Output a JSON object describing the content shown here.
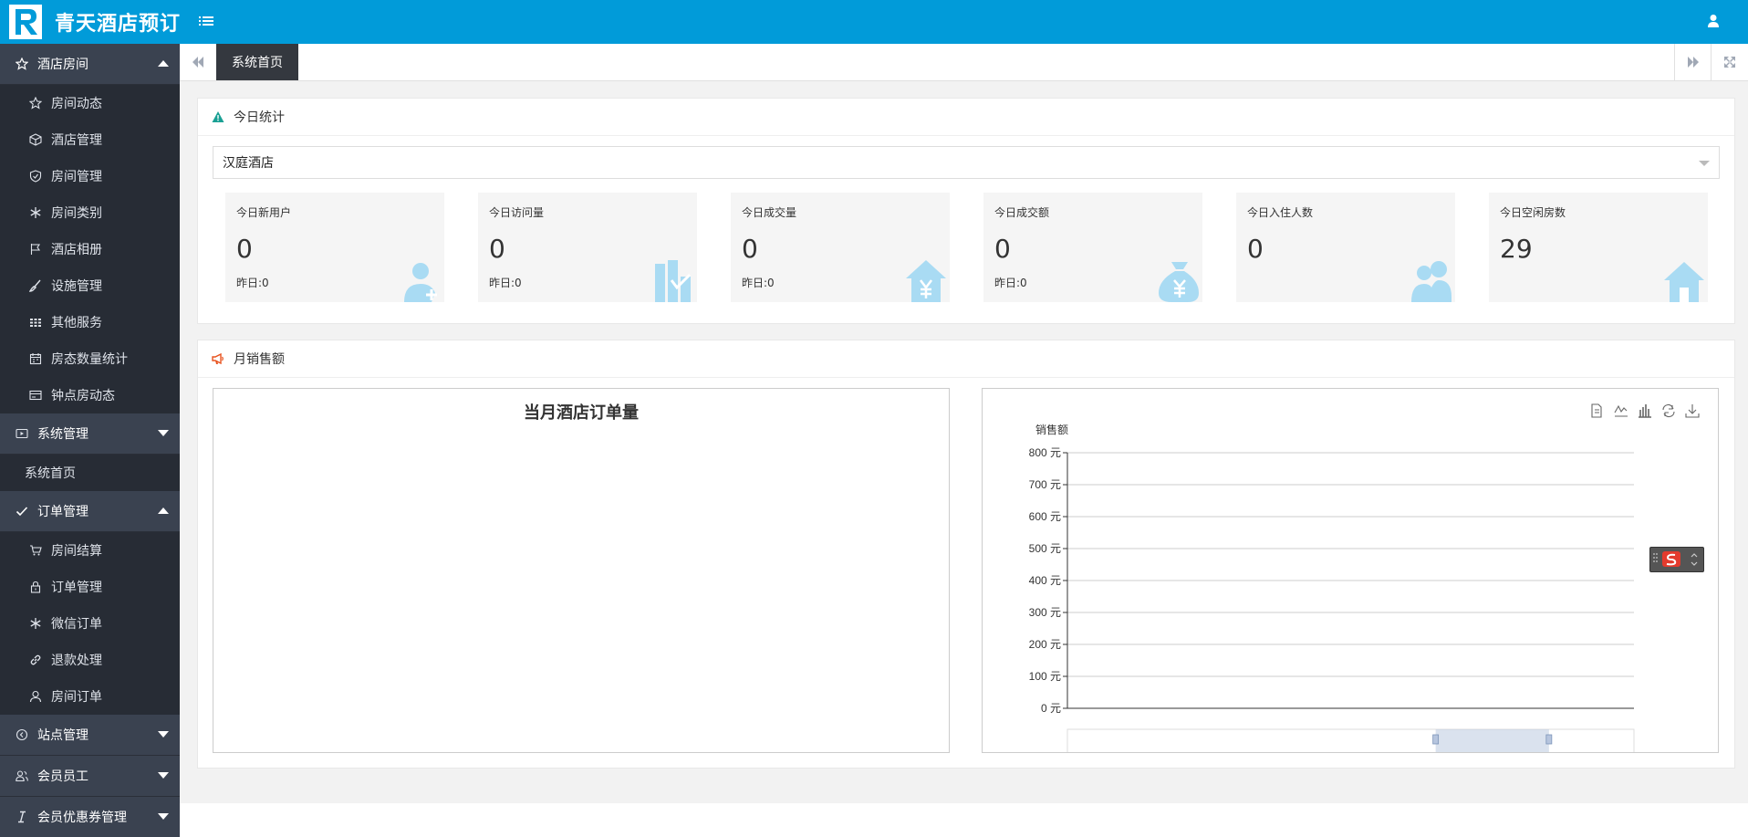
{
  "app": {
    "title": "青天酒店预订"
  },
  "sidebar": {
    "groups": [
      {
        "label": "酒店房间",
        "expanded": true,
        "icon": "star-icon",
        "items": [
          {
            "label": "房间动态",
            "icon": "star-icon"
          },
          {
            "label": "酒店管理",
            "icon": "cube-icon"
          },
          {
            "label": "房间管理",
            "icon": "shield-icon"
          },
          {
            "label": "房间类别",
            "icon": "snowflake-icon"
          },
          {
            "label": "酒店相册",
            "icon": "flag-icon"
          },
          {
            "label": "设施管理",
            "icon": "brush-icon"
          },
          {
            "label": "其他服务",
            "icon": "grid-icon"
          },
          {
            "label": "房态数量统计",
            "icon": "calendar-icon"
          },
          {
            "label": "钟点房动态",
            "icon": "card-icon"
          }
        ]
      },
      {
        "label": "系统管理",
        "expanded": false,
        "icon": "screen-icon",
        "items": [
          {
            "label": "系统首页"
          }
        ]
      },
      {
        "label": "订单管理",
        "expanded": true,
        "icon": "check-icon",
        "items": [
          {
            "label": "房间结算",
            "icon": "cart-icon"
          },
          {
            "label": "订单管理",
            "icon": "lock-icon"
          },
          {
            "label": "微信订单",
            "icon": "snowflake-icon"
          },
          {
            "label": "退款处理",
            "icon": "link-icon"
          },
          {
            "label": "房间订单",
            "icon": "user-icon"
          }
        ]
      },
      {
        "label": "站点管理",
        "expanded": false,
        "icon": "circle-arrow-icon"
      },
      {
        "label": "会员员工",
        "expanded": false,
        "icon": "users-icon"
      },
      {
        "label": "会员优惠券管理",
        "expanded": false,
        "icon": "italic-icon"
      }
    ]
  },
  "tabs": {
    "active": "系统首页"
  },
  "today_stats": {
    "title": "今日统计",
    "hotel_select_value": "汉庭酒店",
    "cards": [
      {
        "label": "今日新用户",
        "value": "0",
        "yesterday": "昨日:0",
        "icon": "user-add-icon"
      },
      {
        "label": "今日访问量",
        "value": "0",
        "yesterday": "昨日:0",
        "icon": "bar-chart-icon"
      },
      {
        "label": "今日成交量",
        "value": "0",
        "yesterday": "昨日:0",
        "icon": "house-yen-icon"
      },
      {
        "label": "今日成交额",
        "value": "0",
        "yesterday": "昨日:0",
        "icon": "money-bag-icon"
      },
      {
        "label": "今日入住人数",
        "value": "0",
        "icon": "users-icon"
      },
      {
        "label": "今日空闲房数",
        "value": "29",
        "icon": "house-icon"
      }
    ]
  },
  "monthly_sales": {
    "title": "月销售额",
    "left_chart_title": "当月酒店订单量",
    "toolbox": [
      "data-view-icon",
      "line-icon",
      "bar-icon",
      "restore-icon",
      "download-icon"
    ]
  },
  "chart_data": {
    "type": "bar",
    "ylabel": "销售额",
    "ylim": [
      0,
      800
    ],
    "y_ticks": [
      "0 元",
      "100 元",
      "200 元",
      "300 元",
      "400 元",
      "500 元",
      "600 元",
      "700 元",
      "800 元"
    ],
    "categories": [],
    "series": [],
    "grid": true,
    "datazoom": {
      "start": 0.65,
      "end": 0.85
    }
  },
  "colors": {
    "header": "#019bd9",
    "sidebar": "#2f3540",
    "accent": "#0d7ee0"
  }
}
